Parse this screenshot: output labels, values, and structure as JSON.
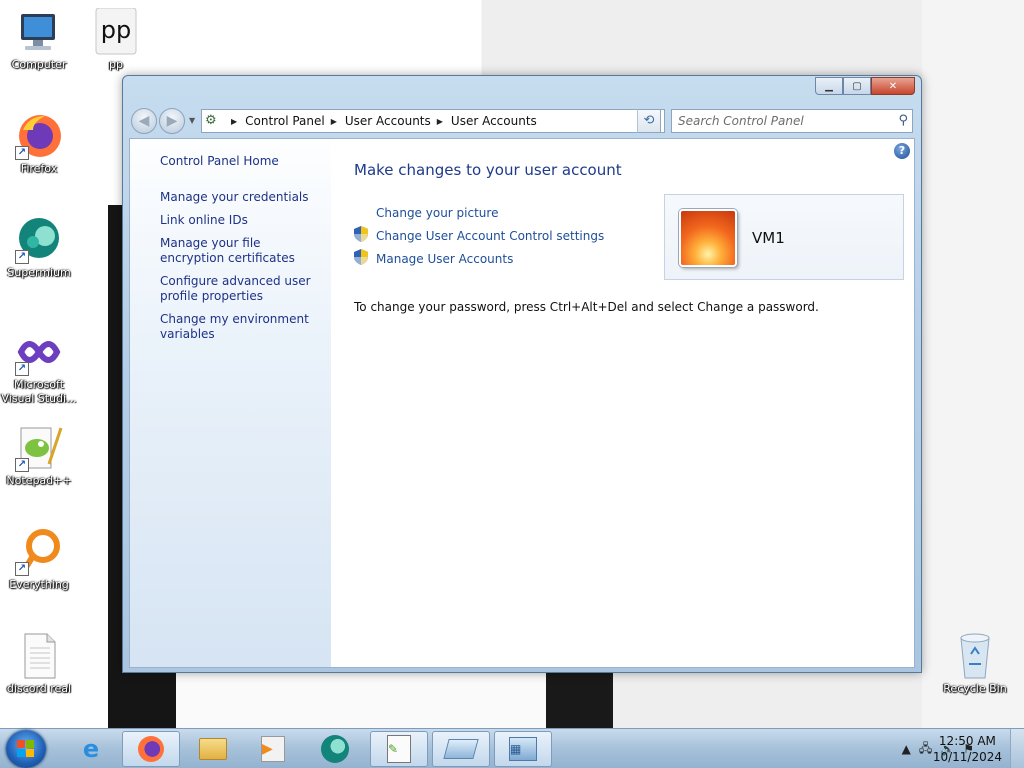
{
  "desktop": {
    "icons": [
      {
        "label": "Computer"
      },
      {
        "label": "pp"
      },
      {
        "label": "Firefox"
      },
      {
        "label": "Supermium"
      },
      {
        "label": "Microsoft Visual Studi..."
      },
      {
        "label": "Notepad++"
      },
      {
        "label": "Everything"
      },
      {
        "label": "discord real"
      },
      {
        "label": "Recycle Bin"
      }
    ]
  },
  "window": {
    "breadcrumb": [
      "Control Panel",
      "User Accounts",
      "User Accounts"
    ],
    "search_placeholder": "Search Control Panel",
    "left_nav": {
      "home": "Control Panel Home",
      "links": [
        "Manage your credentials",
        "Link online IDs",
        "Manage your file encryption certificates",
        "Configure advanced user profile properties",
        "Change my environment variables"
      ]
    },
    "main": {
      "heading": "Make changes to your user account",
      "tasks": [
        {
          "label": "Change your picture",
          "shield": false
        },
        {
          "label": "Change User Account Control settings",
          "shield": true
        },
        {
          "label": "Manage User Accounts",
          "shield": true
        }
      ],
      "info": "To change your password, press Ctrl+Alt+Del and select Change a password.",
      "user_name": "VM1"
    }
  },
  "taskbar": {
    "pinned": [
      "internet-explorer",
      "firefox",
      "file-explorer",
      "media-player",
      "supermium",
      "notepad-plus-plus",
      "remote-desktop",
      "control-panel"
    ],
    "clock_time": "12:50 AM",
    "clock_date": "10/11/2024"
  },
  "colors": {
    "link": "#1e4e9a",
    "heading": "#1e3a8a",
    "window_frame": "#b7d0e8"
  }
}
